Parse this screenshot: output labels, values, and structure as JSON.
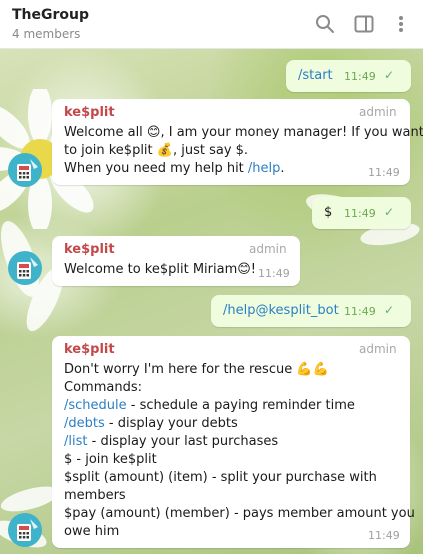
{
  "header": {
    "title": "TheGroup",
    "subtitle": "4 members"
  },
  "messages": {
    "m1": {
      "text": "/start",
      "time": "11:49",
      "check": "✓"
    },
    "m2": {
      "sender": "ke$plit",
      "role": "admin",
      "line1_a": "Welcome all ",
      "emoji1": "😊",
      "line1_b": ", I am your money manager! If you want",
      "line2_a": "to join ke$plit ",
      "emoji2": "💰",
      "line2_b": ", just say $.",
      "line3_a": "When you need my help hit ",
      "line3_link": "/help",
      "line3_b": ".",
      "time": "11:49"
    },
    "m3": {
      "text": "$",
      "time": "11:49",
      "check": "✓"
    },
    "m4": {
      "sender": "ke$plit",
      "role": "admin",
      "text_a": "Welcome to ke$plit Miriam",
      "emoji": "😊",
      "text_b": "!",
      "time": "11:49"
    },
    "m5": {
      "text": "/help@kesplit_bot",
      "time": "11:49",
      "check": "✓"
    },
    "m6": {
      "sender": "ke$plit",
      "role": "admin",
      "line1": "Don't worry I'm here for the rescue ",
      "emoji": "💪💪",
      "line2": "Commands:",
      "cmd1": "/schedule",
      "cmd1_desc": " - schedule a paying reminder time",
      "cmd2": "/debts",
      "cmd2_desc": " - display your debts",
      "cmd3": "/list",
      "cmd3_desc": " - display your last purchases",
      "line6": "$ - join ke$plit",
      "line7": "$split (amount) (item) - split your purchase with",
      "line8": "members",
      "line9": "$pay (amount) (member) - pays member amount you",
      "line10": "owe him",
      "time": "11:49"
    }
  },
  "icons": {
    "search": "search-icon",
    "sidebar": "sidebar-toggle-icon",
    "more": "more-vertical-icon",
    "avatar": "calculator-avatar-icon"
  },
  "colors": {
    "outgoing_bubble": "#effdde",
    "incoming_bubble": "#ffffff",
    "sender_name": "#c3484a",
    "link": "#2a7fc4",
    "check": "#5fb36c"
  }
}
